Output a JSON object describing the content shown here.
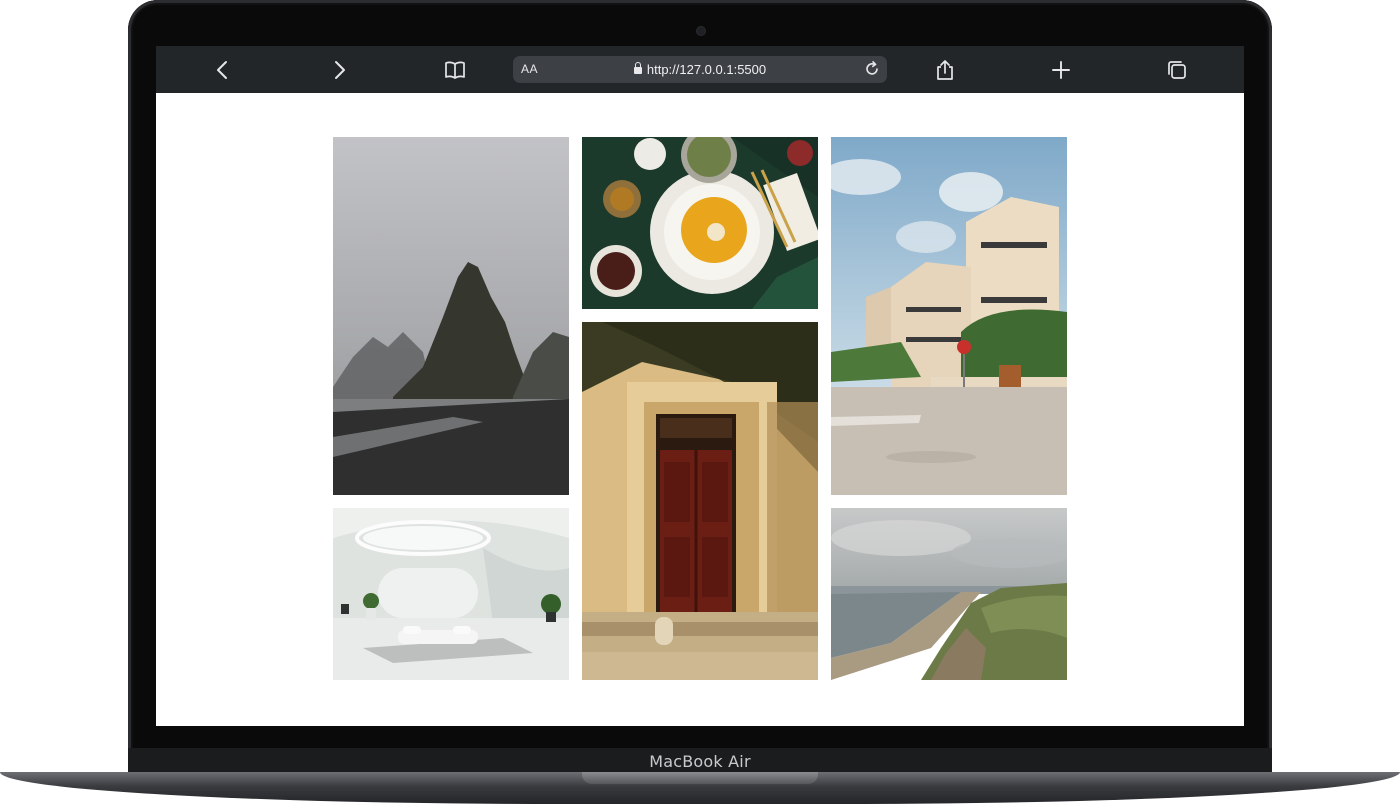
{
  "device": {
    "label": "MacBook Air"
  },
  "browser": {
    "text_size_label": "AA",
    "url": "http://127.0.0.1:5500",
    "icons": {
      "back": "chevron-left-icon",
      "forward": "chevron-right-icon",
      "bookmarks": "book-icon",
      "reload": "reload-icon",
      "share": "share-icon",
      "new_tab": "plus-icon",
      "tabs": "tabs-icon"
    }
  },
  "gallery": {
    "photos": [
      {
        "subject": "foggy-sea-stack"
      },
      {
        "subject": "pumpkin-soup-table"
      },
      {
        "subject": "white-apartment-street"
      },
      {
        "subject": "wooden-door"
      },
      {
        "subject": "white-interior"
      },
      {
        "subject": "coastal-dunes"
      }
    ]
  },
  "colors": {
    "toolbar": "#232629",
    "urlbar": "#3d4044",
    "bezel": "#0a0a0b",
    "page": "#ffffff"
  }
}
